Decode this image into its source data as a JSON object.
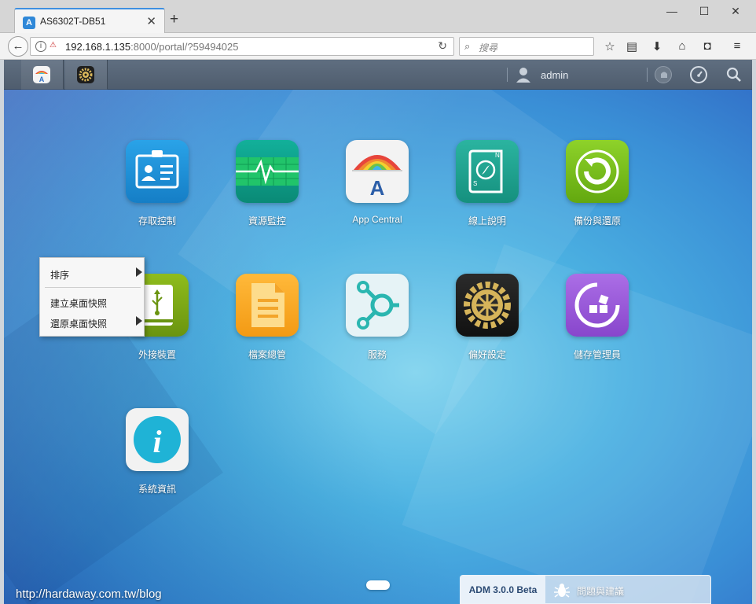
{
  "browser": {
    "tab_title": "AS6302T-DB51",
    "url_host": "192.168.1.135",
    "url_rest": ":8000/portal/?59494025",
    "search_placeholder": "搜尋"
  },
  "adm_topbar": {
    "username": "admin"
  },
  "apps": [
    {
      "label": "存取控制",
      "icon": "id-card-icon",
      "color": "#1e8fd6"
    },
    {
      "label": "資源監控",
      "icon": "heartbeat-monitor-icon",
      "color": "#0fa08a"
    },
    {
      "label": "App Central",
      "icon": "app-central-icon",
      "color": "#f2f2f2"
    },
    {
      "label": "線上說明",
      "icon": "help-book-icon",
      "color": "#22a18f"
    },
    {
      "label": "備份與還原",
      "icon": "backup-restore-icon",
      "color": "#78c21a"
    },
    {
      "label": "外接裝置",
      "icon": "usb-drive-icon",
      "color": "#7bab14"
    },
    {
      "label": "檔案總管",
      "icon": "file-document-icon",
      "color": "#f5a623"
    },
    {
      "label": "服務",
      "icon": "services-icon",
      "color": "#e8f4f6"
    },
    {
      "label": "偏好設定",
      "icon": "gear-icon",
      "color": "#1e1e1e"
    },
    {
      "label": "儲存管理員",
      "icon": "storage-manager-icon",
      "color": "#9b59d6"
    },
    {
      "label": "系統資訊",
      "icon": "info-icon",
      "color": "#f0f0f0"
    }
  ],
  "context_menu": {
    "items": [
      {
        "label": "排序",
        "has_submenu": true
      },
      {
        "label": "建立桌面快照",
        "has_submenu": false
      },
      {
        "label": "還原桌面快照",
        "has_submenu": true
      }
    ]
  },
  "bottom_panel": {
    "version": "ADM 3.0.0 Beta",
    "feedback": "問題與建議"
  },
  "watermark": "http://hardaway.com.tw/blog"
}
